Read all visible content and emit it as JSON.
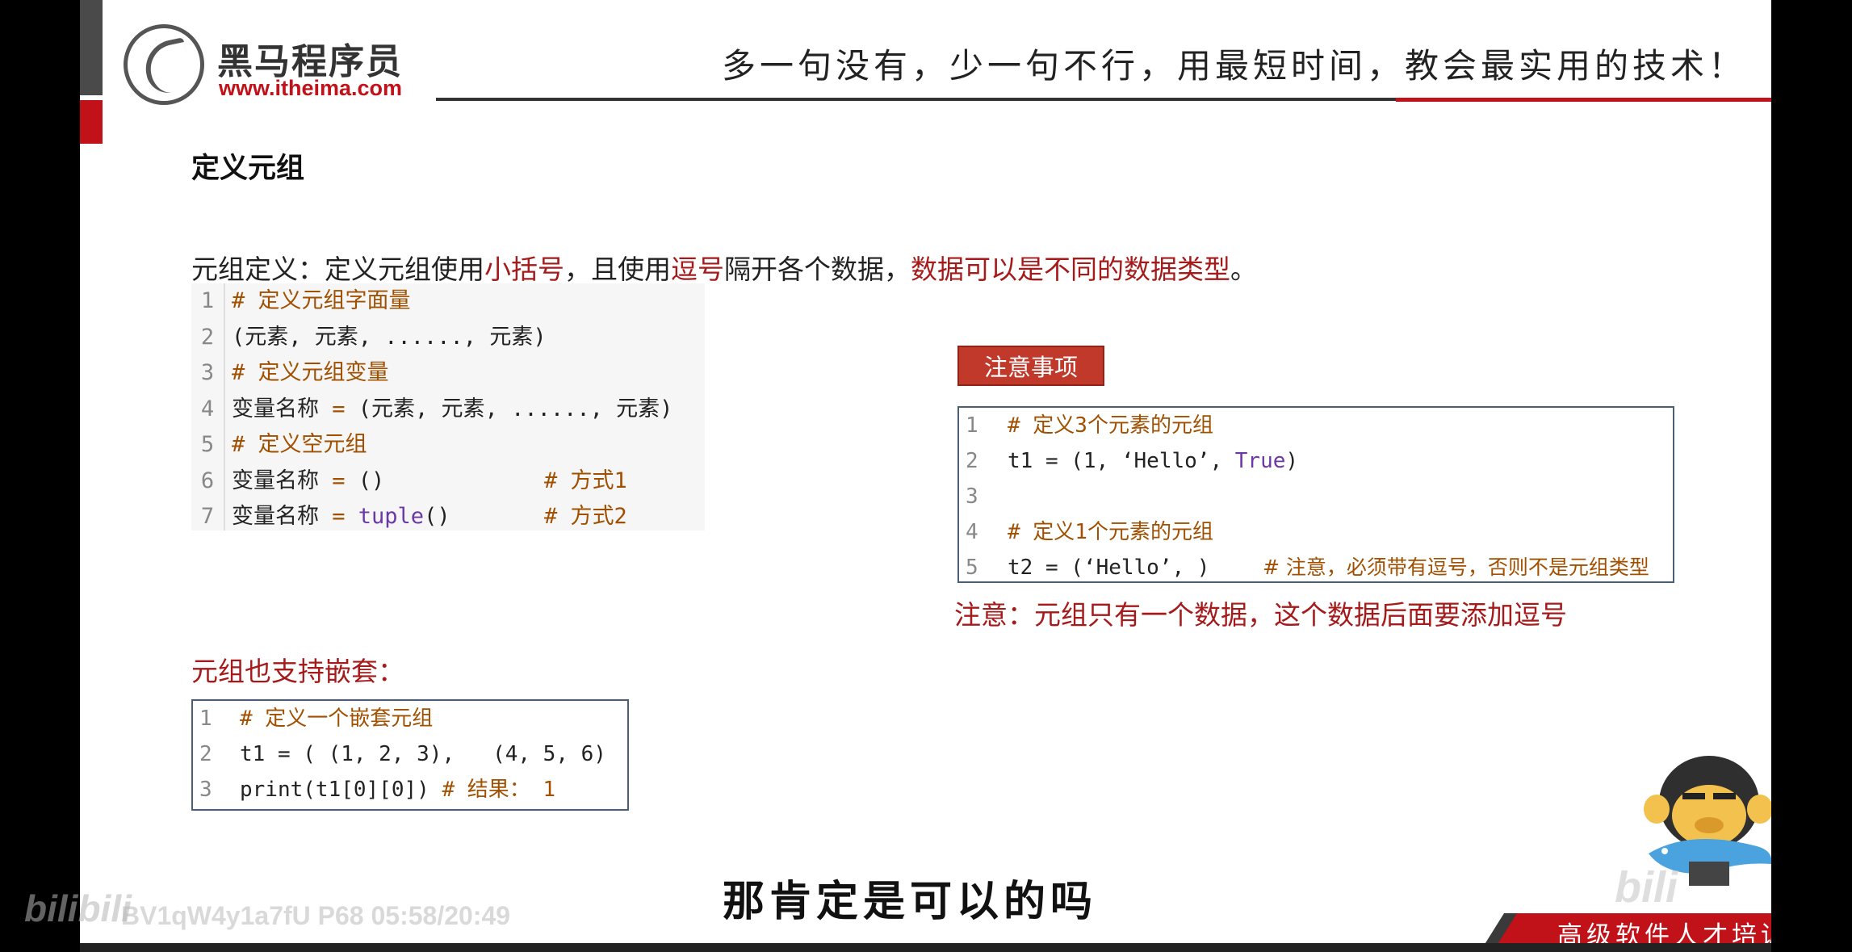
{
  "header": {
    "logo_name": "黑马程序员",
    "logo_url": "www.itheima.com",
    "slogan": "多一句没有，少一句不行，用最短时间，教会最实用的技术！"
  },
  "page_title": "定义元组",
  "intro": {
    "p1": "元组定义：定义元组使用",
    "r1": "小括号",
    "p2": "，且使用",
    "r2": "逗号",
    "p3": "隔开各个数据，",
    "r3": "数据可以是不同的数据类型",
    "p4": "。"
  },
  "code_define": [
    {
      "ln": "1",
      "text": "# 定义元组字面量"
    },
    {
      "ln": "2",
      "text": "(元素, 元素, ......, 元素)"
    },
    {
      "ln": "3",
      "text": "# 定义元组变量"
    },
    {
      "ln": "4",
      "a": "变量名称 ",
      "op": "=",
      "b": " (元素, 元素, ......, 元素)"
    },
    {
      "ln": "5",
      "text": "# 定义空元组"
    },
    {
      "ln": "6",
      "a": "变量名称 ",
      "op": "=",
      "b": " ()",
      "comment": "# 方式1"
    },
    {
      "ln": "7",
      "a": "变量名称 ",
      "op": "=",
      "kw": " tuple",
      "b": "()",
      "comment": "# 方式2"
    }
  ],
  "notice": {
    "button_label": "注意事项",
    "code": [
      {
        "ln": "1",
        "text": "# 定义3个元素的元组"
      },
      {
        "ln": "2",
        "a": "t1 = (1, ‘Hello’, ",
        "kw": "True",
        "b": ")"
      },
      {
        "ln": "3",
        "text": ""
      },
      {
        "ln": "4",
        "text": "# 定义1个元素的元组"
      },
      {
        "ln": "5",
        "a": "t2 = (‘Hello’, )",
        "comment": "# 注意，必须带有逗号，否则不是元组类型"
      }
    ],
    "note": "注意：元组只有一个数据，这个数据后面要添加逗号"
  },
  "nested": {
    "label": "元组也支持嵌套：",
    "code": [
      {
        "ln": "1",
        "text": "# 定义一个嵌套元组"
      },
      {
        "ln": "2",
        "text": "t1 = ( (1, 2, 3),   (4, 5, 6)"
      },
      {
        "ln": "3",
        "a": "print(t1[0][0])",
        "comment": " # 结果： 1"
      }
    ]
  },
  "footer": {
    "tagline": "高级软件人才培训专家"
  },
  "video": {
    "subtitle": "那肯定是可以的吗",
    "watermark_logo": "bilibili",
    "watermark_info": "BV1qW4y1a7fU P68 05:58/20:49",
    "corner_watermark": "bili"
  },
  "colors": {
    "accent_red": "#c1121a",
    "text_red": "#a51a1a",
    "comment": "#a05000",
    "keyword": "#6b38a8"
  }
}
